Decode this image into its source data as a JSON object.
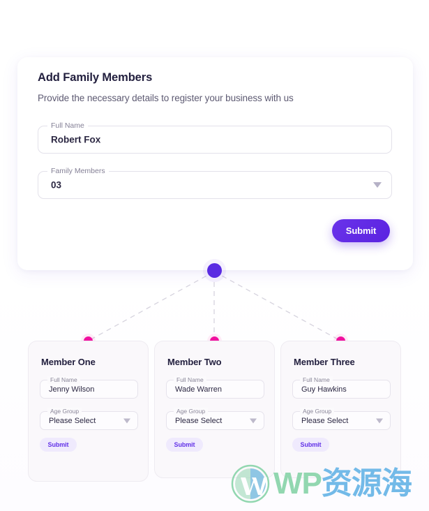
{
  "panel": {
    "title": "Add Family Members",
    "subtitle": "Provide the necessary details to register your business with us",
    "fields": [
      {
        "label": "Full Name",
        "value": "Robert Fox",
        "type": "text"
      },
      {
        "label": "Family Members",
        "value": "03",
        "type": "select",
        "icon": "chevron-down-icon"
      }
    ],
    "submit_label": "Submit"
  },
  "connector": {
    "root_color": "#5a2be2",
    "leaf_color": "#f0119f",
    "line_style": "dashed",
    "line_color": "#d8d5e0"
  },
  "members": [
    {
      "title": "Member One",
      "name_label": "Full Name",
      "name_value": "Jenny Wilson",
      "age_label": "Age Group",
      "age_value": "Please Select",
      "submit_label": "Submit"
    },
    {
      "title": "Member Two",
      "name_label": "Full Name",
      "name_value": "Wade Warren",
      "age_label": "Age Group",
      "age_value": "Please Select",
      "submit_label": "Submit"
    },
    {
      "title": "Member Three",
      "name_label": "Full Name",
      "name_value": "Guy Hawkins",
      "age_label": "Age Group",
      "age_value": "Please Select",
      "submit_label": "Submit"
    }
  ],
  "watermark": {
    "latin": "WP",
    "cjk": "资源海"
  },
  "colors": {
    "accent_purple": "#5a2be2",
    "accent_pink": "#f0119f",
    "title_text": "#23203f",
    "muted_text": "#837f95",
    "card_bg": "#faf8fb"
  }
}
